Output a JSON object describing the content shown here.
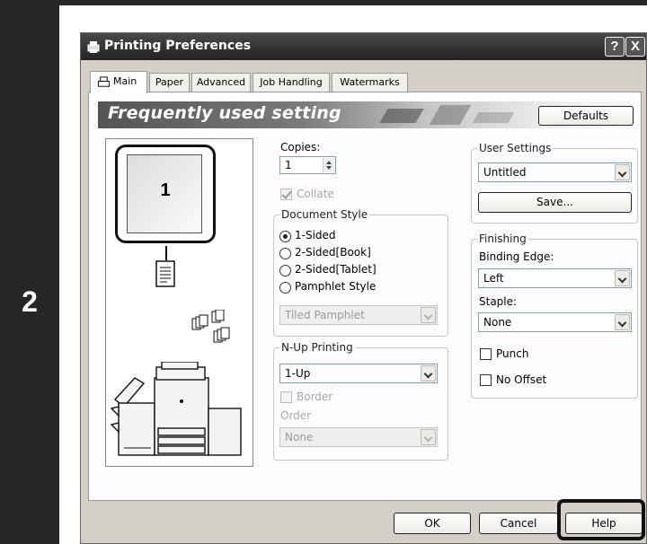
{
  "step_number": "2",
  "dialog": {
    "title": "Printing Preferences",
    "help_glyph": "?",
    "close_glyph": "X"
  },
  "tabs": [
    {
      "label": "Main",
      "active": true
    },
    {
      "label": "Paper"
    },
    {
      "label": "Advanced"
    },
    {
      "label": "Job Handling"
    },
    {
      "label": "Watermarks"
    }
  ],
  "banner": {
    "title": "Frequently used setting",
    "defaults_label": "Defaults"
  },
  "preview": {
    "page_number": "1"
  },
  "copies": {
    "label": "Copies:",
    "value": "1"
  },
  "collate": {
    "label": "Collate",
    "checked": true,
    "disabled": true
  },
  "document_style": {
    "label": "Document Style",
    "options": [
      "1-Sided",
      "2-Sided[Book]",
      "2-Sided[Tablet]",
      "Pamphlet Style"
    ],
    "selected": "1-Sided",
    "pamphlet_select": "Tiled Pamphlet"
  },
  "nup": {
    "label": "N-Up Printing",
    "value": "1-Up",
    "border_label": "Border",
    "order_label": "Order",
    "order_value": "None"
  },
  "user_settings": {
    "label": "User Settings",
    "value": "Untitled",
    "save_label": "Save..."
  },
  "finishing": {
    "label": "Finishing",
    "binding_label": "Binding Edge:",
    "binding_value": "Left",
    "staple_label": "Staple:",
    "staple_value": "None",
    "punch_label": "Punch",
    "no_offset_label": "No Offset"
  },
  "footer": {
    "ok_label": "OK",
    "cancel_label": "Cancel",
    "help_label": "Help"
  },
  "icons": [
    "printer-icon",
    "tab-printer-icon",
    "document-icon",
    "stack-icon",
    "copier-machine-icon"
  ]
}
